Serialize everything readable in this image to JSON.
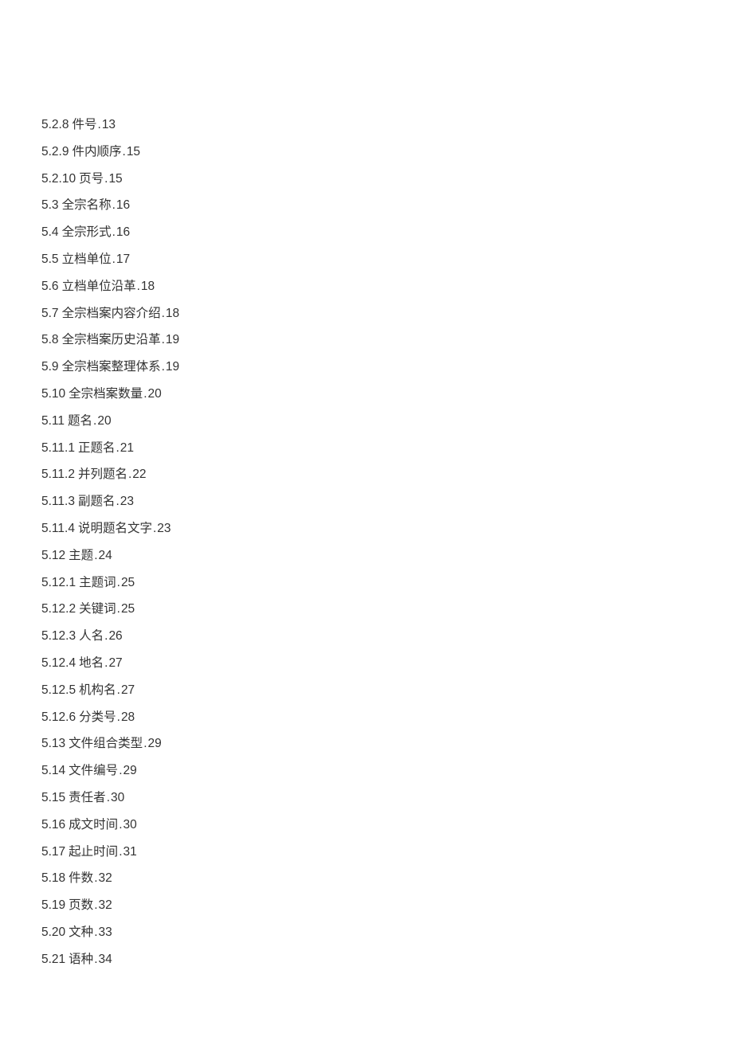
{
  "toc": {
    "entries": [
      {
        "number": "5.2.8",
        "title": "件号",
        "page": "13"
      },
      {
        "number": "5.2.9",
        "title": "件内顺序",
        "page": "15"
      },
      {
        "number": "5.2.10",
        "title": "页号",
        "page": "15"
      },
      {
        "number": "5.3",
        "title": "全宗名称",
        "page": "16"
      },
      {
        "number": "5.4",
        "title": "全宗形式",
        "page": "16"
      },
      {
        "number": "5.5",
        "title": "立档单位",
        "page": "17"
      },
      {
        "number": "5.6",
        "title": "立档单位沿革",
        "page": "18"
      },
      {
        "number": "5.7",
        "title": "全宗档案内容介绍",
        "page": "18"
      },
      {
        "number": "5.8",
        "title": "全宗档案历史沿革",
        "page": "19"
      },
      {
        "number": "5.9",
        "title": "全宗档案整理体系",
        "page": "19"
      },
      {
        "number": "5.10",
        "title": "全宗档案数量",
        "page": "20"
      },
      {
        "number": "5.11",
        "title": "题名",
        "page": "20"
      },
      {
        "number": "5.11.1",
        "title": "正题名",
        "page": "21"
      },
      {
        "number": "5.11.2",
        "title": "并列题名",
        "page": "22"
      },
      {
        "number": "5.11.3",
        "title": "副题名",
        "page": "23"
      },
      {
        "number": "5.11.4",
        "title": "说明题名文字",
        "page": "23"
      },
      {
        "number": "5.12",
        "title": "主题",
        "page": "24"
      },
      {
        "number": "5.12.1",
        "title": "主题词",
        "page": "25"
      },
      {
        "number": "5.12.2",
        "title": "关键词",
        "page": "25"
      },
      {
        "number": "5.12.3",
        "title": "人名",
        "page": "26"
      },
      {
        "number": "5.12.4",
        "title": "地名",
        "page": "27"
      },
      {
        "number": "5.12.5",
        "title": "机构名",
        "page": "27"
      },
      {
        "number": "5.12.6",
        "title": "分类号",
        "page": "28"
      },
      {
        "number": "5.13",
        "title": "文件组合类型",
        "page": "29"
      },
      {
        "number": "5.14",
        "title": "文件编号",
        "page": "29"
      },
      {
        "number": "5.15",
        "title": "责任者",
        "page": "30"
      },
      {
        "number": "5.16",
        "title": "成文时间",
        "page": "30"
      },
      {
        "number": "5.17",
        "title": "起止时间",
        "page": "31"
      },
      {
        "number": "5.18",
        "title": "件数",
        "page": "32"
      },
      {
        "number": "5.19",
        "title": "页数",
        "page": "32"
      },
      {
        "number": "5.20",
        "title": "文种",
        "page": "33"
      },
      {
        "number": "5.21",
        "title": "语种",
        "page": "34"
      }
    ],
    "separator": "."
  }
}
